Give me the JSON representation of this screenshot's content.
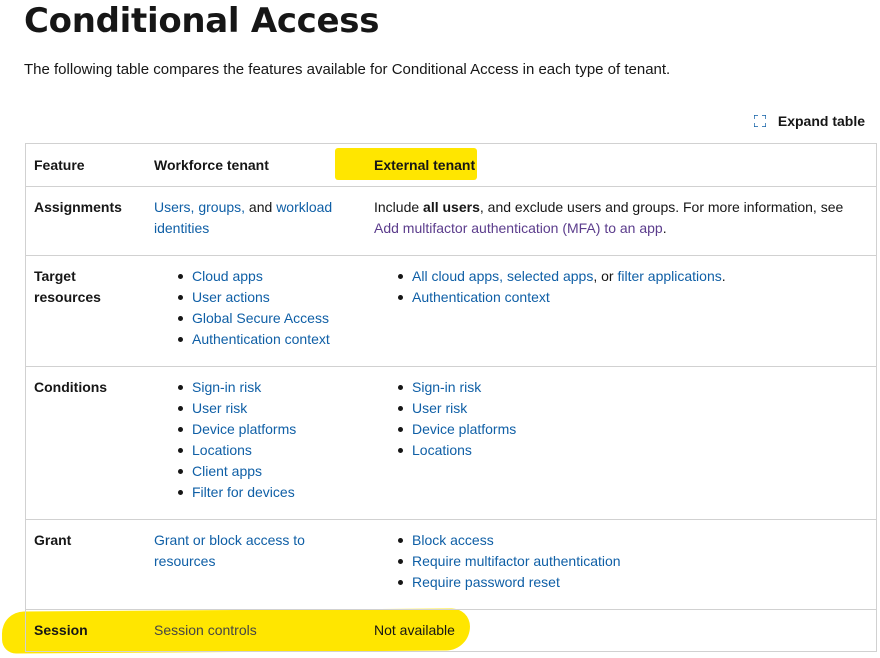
{
  "page": {
    "title": "Conditional Access",
    "intro": "The following table compares the features available for Conditional Access in each type of tenant."
  },
  "expand": {
    "label": "Expand table",
    "icon": "expand-icon"
  },
  "highlight_color": "#ffe600",
  "link_color": "#0f5fa6",
  "table": {
    "headers": [
      "Feature",
      "Workforce tenant",
      "External tenant"
    ],
    "assignments": {
      "label": "Assignments",
      "wf_link1": "Users, groups,",
      "wf_and": " and ",
      "wf_link2": "workload identities",
      "ext_pre": "Include ",
      "ext_bold": "all users",
      "ext_mid": ", and exclude users and groups. For more information, see ",
      "ext_link": "Add multifactor authentication (MFA) to an app",
      "ext_end": "."
    },
    "target": {
      "label": "Target resources",
      "wf_items": [
        "Cloud apps",
        "User actions",
        "Global Secure Access",
        "Authentication context"
      ],
      "ext_item1_link1": "All cloud apps, selected apps",
      "ext_item1_mid": ", or ",
      "ext_item1_link2": "filter applications",
      "ext_item1_end": ".",
      "ext_item2": "Authentication context"
    },
    "conditions": {
      "label": "Conditions",
      "wf_items": [
        "Sign-in risk",
        "User risk",
        "Device platforms",
        "Locations",
        "Client apps",
        "Filter for devices"
      ],
      "ext_items": [
        "Sign-in risk",
        "User risk",
        "Device platforms",
        "Locations"
      ]
    },
    "grant": {
      "label": "Grant",
      "wf_link": "Grant or block access to resources",
      "ext_items": [
        "Block access",
        "Require multifactor authentication",
        "Require password reset"
      ]
    },
    "session": {
      "label": "Session",
      "wf": "Session controls",
      "ext": "Not available"
    }
  }
}
